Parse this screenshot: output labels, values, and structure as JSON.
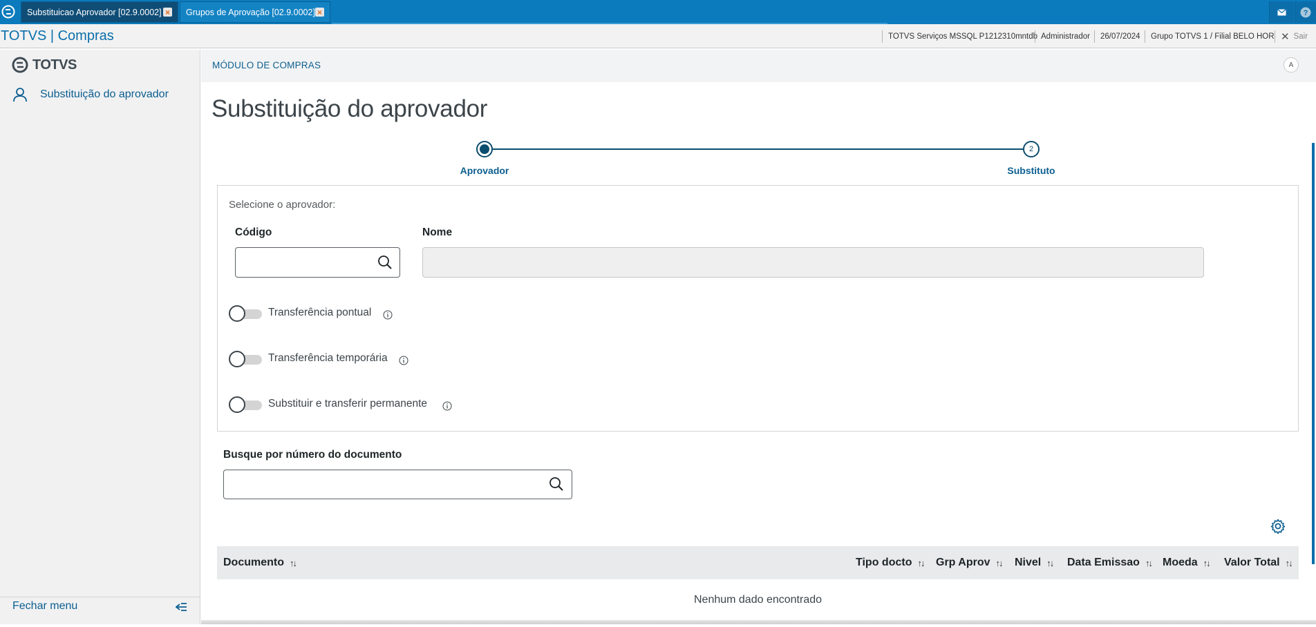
{
  "tabs": [
    {
      "label": "Substituicao Aprovador [02.9.0002]",
      "active": true
    },
    {
      "label": "Grupos de Aprovação [02.9.0002]",
      "active": false
    }
  ],
  "app_title": "TOTVS | Compras",
  "status": {
    "environment": "TOTVS Serviços MSSQL P1212310mntdb",
    "user": "Administrador",
    "date": "26/07/2024",
    "company": "Grupo TOTVS 1 / Filial BELO HOR",
    "exit": "Sair"
  },
  "sidebar": {
    "brand": "TOTVS",
    "items": [
      {
        "label": "Substituição do aprovador",
        "icon": "user-icon"
      }
    ],
    "close_menu": "Fechar menu"
  },
  "header": {
    "module": "MÓDULO DE COMPRAS",
    "avatar_initial": "A"
  },
  "page_title": "Substituição do aprovador",
  "stepper": {
    "current": 1,
    "steps": [
      {
        "label": "Aprovador",
        "number": "1"
      },
      {
        "label": "Substituto",
        "number": "2"
      }
    ]
  },
  "form": {
    "instruction": "Selecione o aprovador:",
    "codigo_label": "Código",
    "codigo_value": "",
    "nome_label": "Nome",
    "nome_value": "",
    "switches": [
      {
        "label": "Transferência pontual",
        "on": false
      },
      {
        "label": "Transferência temporária",
        "on": false
      },
      {
        "label": "Substituir e transferir permanente",
        "on": false
      }
    ]
  },
  "doc_search": {
    "label": "Busque por número do documento",
    "value": ""
  },
  "table": {
    "columns": [
      "Documento",
      "Tipo docto",
      "Grp Aprov",
      "Nivel",
      "Data Emissao",
      "Moeda",
      "Valor Total"
    ],
    "empty_message": "Nenhum dado encontrado"
  },
  "colors": {
    "primary": "#0b7bbd",
    "accent": "#0b5e8f",
    "stepper": "#0b4d6e",
    "close_icon": "#e46b1a"
  }
}
